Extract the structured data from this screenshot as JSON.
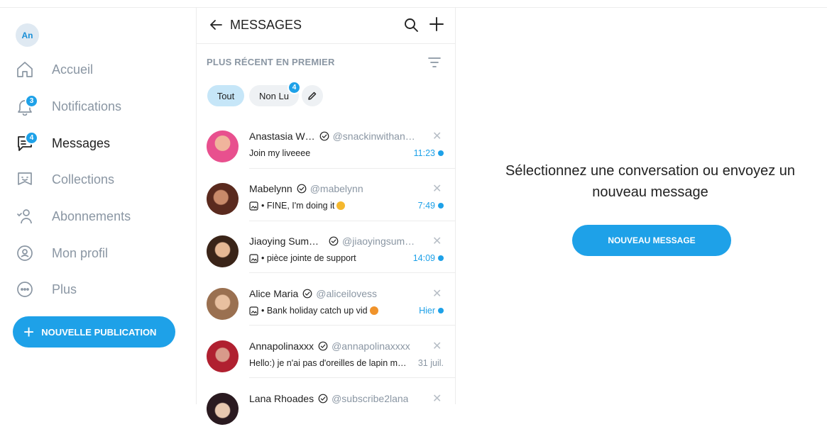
{
  "sidebar": {
    "avatar_initials": "An",
    "items": [
      {
        "label": "Accueil",
        "icon": "home-icon"
      },
      {
        "label": "Notifications",
        "icon": "bell-icon",
        "badge": "3"
      },
      {
        "label": "Messages",
        "icon": "chat-icon",
        "badge": "4",
        "active": true
      },
      {
        "label": "Collections",
        "icon": "bookmark-icon"
      },
      {
        "label": "Abonnements",
        "icon": "subscriptions-icon"
      },
      {
        "label": "Mon profil",
        "icon": "profile-icon"
      },
      {
        "label": "Plus",
        "icon": "more-icon"
      }
    ],
    "new_post_label": "NOUVELLE PUBLICATION"
  },
  "messages": {
    "title": "MESSAGES",
    "sort_label": "PLUS RÉCENT EN PREMIER",
    "filters": {
      "all_label": "Tout",
      "unread_label": "Non Lu",
      "unread_badge": "4"
    },
    "conversations": [
      {
        "name": "Anastasia W…",
        "handle": "@snackinwithana…",
        "preview": "Join my liveeee",
        "time": "11:23",
        "unread": true,
        "has_image": false
      },
      {
        "name": "Mabelynn",
        "handle": "@mabelynn",
        "preview": "• FINE, I'm doing it",
        "time": "7:49",
        "unread": true,
        "has_image": true
      },
      {
        "name": "Jiaoying Sum…",
        "handle": "@jiaoyingsum…",
        "preview": "• pièce jointe de support",
        "time": "14:09",
        "unread": true,
        "has_image": true
      },
      {
        "name": "Alice Maria",
        "handle": "@aliceilovess",
        "preview": "• Bank holiday catch up vid",
        "time": "Hier",
        "unread": true,
        "has_image": true
      },
      {
        "name": "Annapolinaxxx",
        "handle": "@annapolinaxxxx",
        "preview": "Hello:) je n'ai pas d'oreilles de lapin m…",
        "time": "31 juil.",
        "unread": false,
        "has_image": false
      },
      {
        "name": "Lana Rhoades",
        "handle": "@subscribe2lana",
        "preview": "",
        "time": "",
        "unread": false,
        "has_image": false
      }
    ]
  },
  "main": {
    "empty_state_text": "Sélectionnez une conversation ou envoyez un nouveau message",
    "new_message_label": "NOUVEAU MESSAGE"
  },
  "colors": {
    "accent": "#1ea1e8",
    "muted": "#8a96a3",
    "chip_active": "#c6e6f8"
  }
}
